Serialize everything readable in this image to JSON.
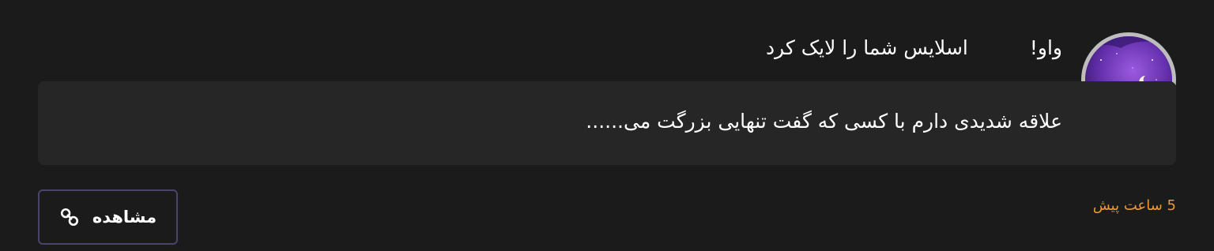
{
  "notification": {
    "exclamation": "واو!",
    "action_text": "اسلایس شما را لایک کرد",
    "message": "علاقه شدیدی دارم با کسی که گفت تنهایی بزرگت می......",
    "time": "5 ساعت پیش",
    "view_button_label": "مشاهده",
    "view_button_icon": "link-icon",
    "avatar_icon": "night-sky-avatar"
  },
  "colors": {
    "background": "#1b1b1b",
    "message_box": "#262626",
    "time_accent": "#e89a3a",
    "button_border": "#4a4568",
    "avatar_border": "#bdbdbd"
  }
}
